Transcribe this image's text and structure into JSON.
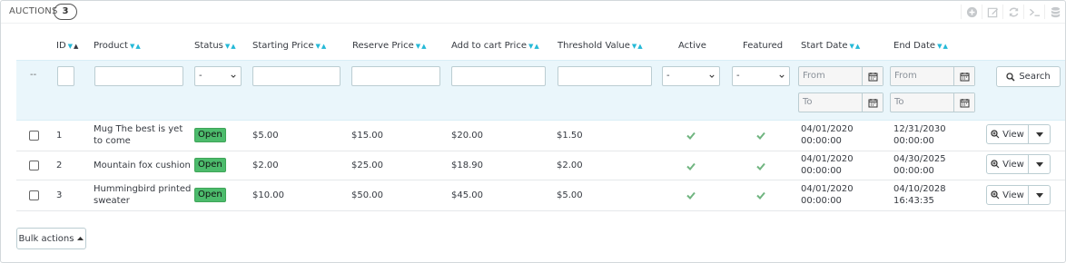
{
  "header": {
    "title": "Auctions",
    "count": "3"
  },
  "toolbar": {
    "icons": [
      "plus-circle-icon",
      "edit-icon",
      "refresh-icon",
      "terminal-icon",
      "database-icon"
    ]
  },
  "columns": {
    "id": "ID",
    "product": "Product",
    "status": "Status",
    "starting_price": "Starting Price",
    "reserve_price": "Reserve Price",
    "add_to_cart_price": "Add to cart Price",
    "threshold_value": "Threshold Value",
    "active": "Active",
    "featured": "Featured",
    "start_date": "Start Date",
    "end_date": "End Date"
  },
  "filters": {
    "bulk_placeholder": "--",
    "status_value": "-",
    "active_value": "-",
    "featured_value": "-",
    "from_placeholder": "From",
    "to_placeholder": "To",
    "search_label": "Search"
  },
  "rows": [
    {
      "id": "1",
      "product": "Mug The best is yet to come",
      "status": "Open",
      "starting_price": "$5.00",
      "reserve_price": "$15.00",
      "add_to_cart_price": "$20.00",
      "threshold_value": "$1.50",
      "active": true,
      "featured": true,
      "start_date": "04/01/2020",
      "start_time": "00:00:00",
      "end_date": "12/31/2030",
      "end_time": "00:00:00",
      "view_label": "View"
    },
    {
      "id": "2",
      "product": "Mountain fox cushion",
      "status": "Open",
      "starting_price": "$2.00",
      "reserve_price": "$25.00",
      "add_to_cart_price": "$18.90",
      "threshold_value": "$2.00",
      "active": true,
      "featured": true,
      "start_date": "04/01/2020",
      "start_time": "00:00:00",
      "end_date": "04/30/2025",
      "end_time": "00:00:00",
      "view_label": "View"
    },
    {
      "id": "3",
      "product": "Hummingbird printed sweater",
      "status": "Open",
      "starting_price": "$10.00",
      "reserve_price": "$50.00",
      "add_to_cart_price": "$45.00",
      "threshold_value": "$5.00",
      "active": true,
      "featured": true,
      "start_date": "04/01/2020",
      "start_time": "00:00:00",
      "end_date": "04/10/2028",
      "end_time": "16:43:35",
      "view_label": "View"
    }
  ],
  "footer": {
    "bulk_actions_label": "Bulk actions"
  },
  "colors": {
    "accent": "#25b9d7",
    "open_badge": "#4cbb6c",
    "check": "#70b580",
    "filter_bg": "#eaf6fb"
  }
}
